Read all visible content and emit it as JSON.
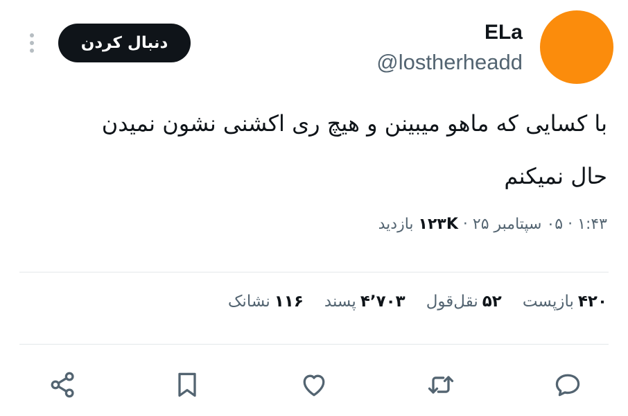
{
  "author": {
    "name": "ELa",
    "handle": "@lostherheadd",
    "avatar_color": "#fb8c0c"
  },
  "follow_button": "دنبال کردن",
  "tweet": {
    "line1": "با کسایی که ماهو میبینن و هیچ ری اکشنی نشون نمیدن",
    "line2": "حال نمیکنم"
  },
  "meta": {
    "time": "۱:۴۳",
    "sep": "·",
    "date": "۰۵ سپتامبر ۲۵",
    "views_count": "۱۲۳K",
    "views_label": "بازدید"
  },
  "stats": {
    "reposts_count": "۴۲۰",
    "reposts_label": "بازپست",
    "quotes_count": "۵۲",
    "quotes_label": "نقل‌قول",
    "likes_count": "۴٬۷۰۳",
    "likes_label": "پسند",
    "bookmarks_count": "۱۱۶",
    "bookmarks_label": "نشانک"
  },
  "actions": [
    "reply-icon",
    "repost-icon",
    "like-icon",
    "bookmark-icon",
    "share-icon"
  ],
  "colors": {
    "text": "#0f1419",
    "secondary": "#536471",
    "divider": "#e3e7ea",
    "button_bg": "#0f1419"
  }
}
